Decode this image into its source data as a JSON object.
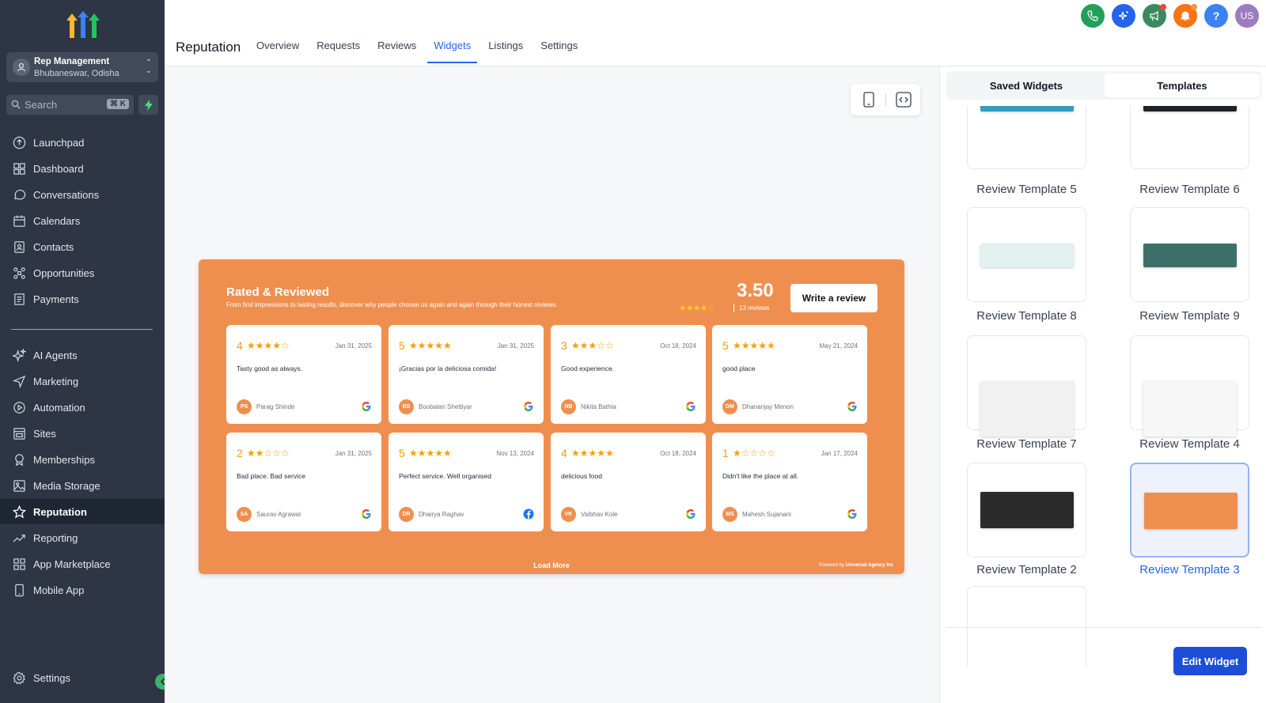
{
  "app": {
    "account_name": "Rep Management",
    "account_location": "Bhubaneswar, Odisha",
    "search_placeholder": "Search",
    "search_shortcut": "⌘ K"
  },
  "sidebar": {
    "items": [
      {
        "label": "Launchpad",
        "icon": "launchpad-icon"
      },
      {
        "label": "Dashboard",
        "icon": "dashboard-icon"
      },
      {
        "label": "Conversations",
        "icon": "chat-icon"
      },
      {
        "label": "Calendars",
        "icon": "calendar-icon"
      },
      {
        "label": "Contacts",
        "icon": "contacts-icon"
      },
      {
        "label": "Opportunities",
        "icon": "opportunities-icon"
      },
      {
        "label": "Payments",
        "icon": "payments-icon"
      },
      {
        "label": "AI Agents",
        "icon": "sparkle-icon"
      },
      {
        "label": "Marketing",
        "icon": "send-icon"
      },
      {
        "label": "Automation",
        "icon": "automation-icon"
      },
      {
        "label": "Sites",
        "icon": "sites-icon"
      },
      {
        "label": "Memberships",
        "icon": "memberships-icon"
      },
      {
        "label": "Media Storage",
        "icon": "image-icon"
      },
      {
        "label": "Reputation",
        "icon": "star-icon"
      },
      {
        "label": "Reporting",
        "icon": "trend-icon"
      },
      {
        "label": "App Marketplace",
        "icon": "grid-icon"
      },
      {
        "label": "Mobile App",
        "icon": "mobile-icon"
      }
    ],
    "settings_label": "Settings"
  },
  "header": {
    "title": "Reputation",
    "tabs": [
      "Overview",
      "Requests",
      "Reviews",
      "Widgets",
      "Listings",
      "Settings"
    ],
    "active_tab": "Widgets",
    "avatar_initials": "US"
  },
  "widget": {
    "title": "Rated & Reviewed",
    "subtitle": "From first impressions to lasting results, discover why people choose us again and again through their honest reviews.",
    "rating": "3.50",
    "review_count": "13 reviews",
    "write_review": "Write a review",
    "load_more": "Load More",
    "powered_prefix": "Powered by",
    "powered_by": "Universal Agency Inc",
    "reviews": [
      {
        "rating": "4",
        "stars": "★★★★☆",
        "date": "Jan 31, 2025",
        "text": "Tasty good as always.",
        "initials": "PS",
        "name": "Parag Shinde",
        "source": "google"
      },
      {
        "rating": "5",
        "stars": "★★★★★",
        "date": "Jan 31, 2025",
        "text": "¡Gracias por la deliciosa comida!",
        "initials": "BS",
        "name": "Boobalan Shettiyar",
        "source": "google"
      },
      {
        "rating": "3",
        "stars": "★★★☆☆",
        "date": "Oct 18, 2024",
        "text": "Good experience.",
        "initials": "NB",
        "name": "Nikita Bathia",
        "source": "google"
      },
      {
        "rating": "5",
        "stars": "★★★★★",
        "date": "May 21, 2024",
        "text": "good place",
        "initials": "DM",
        "name": "Dhananjay Menon",
        "source": "google"
      },
      {
        "rating": "2",
        "stars": "★★☆☆☆",
        "date": "Jan 31, 2025",
        "text": "Bad place. Bad service",
        "initials": "SA",
        "name": "Saurav Agrawal",
        "source": "google"
      },
      {
        "rating": "5",
        "stars": "★★★★★",
        "date": "Nov 13, 2024",
        "text": "Perfect service. Well organised",
        "initials": "DR",
        "name": "Dhairya Raghav",
        "source": "facebook"
      },
      {
        "rating": "4",
        "stars": "★★★★★",
        "date": "Oct 18, 2024",
        "text": "delicious food",
        "initials": "VK",
        "name": "Vaibhav Kole",
        "source": "google"
      },
      {
        "rating": "1",
        "stars": "★☆☆☆☆",
        "date": "Jan 17, 2024",
        "text": "Didn't like the place at all.",
        "initials": "MS",
        "name": "Mahesh Sujanani",
        "source": "google"
      }
    ]
  },
  "panel": {
    "tabs": [
      "Saved Widgets",
      "Templates"
    ],
    "templates": [
      {
        "label": "Review Template 5",
        "color": "#3a9bb8"
      },
      {
        "label": "Review Template 6",
        "color": "#1f2328"
      },
      {
        "label": "Review Template 8",
        "color": "#e3f1ee"
      },
      {
        "label": "Review Template 9",
        "color": "#3d6f6a"
      },
      {
        "label": "Review Template 7",
        "color": "#f1f1f1"
      },
      {
        "label": "Review Template 4",
        "color": "#f7f7f7"
      },
      {
        "label": "Review Template 2",
        "color": "#2b2b2b"
      },
      {
        "label": "Review Template 3",
        "color": "#ef8f4f",
        "selected": true
      }
    ],
    "edit_button": "Edit Widget"
  },
  "colors": {
    "sidebar_bg": "#2e3544",
    "accent": "#2563eb",
    "widget_orange": "#ef8f4f",
    "star": "#f59e0b"
  }
}
